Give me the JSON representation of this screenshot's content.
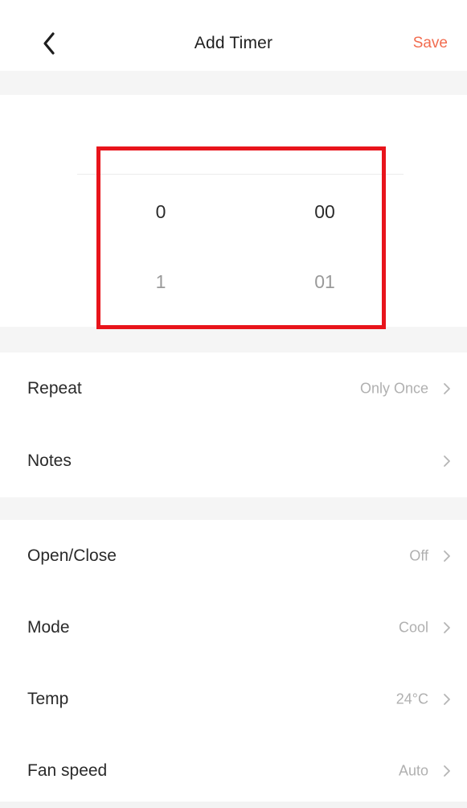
{
  "header": {
    "title": "Add Timer",
    "save_label": "Save",
    "back_icon": "chevron-left-icon"
  },
  "picker": {
    "hours": {
      "selected": "0",
      "next": "1"
    },
    "minutes": {
      "selected": "00",
      "next": "01"
    }
  },
  "settings_group_1": [
    {
      "label": "Repeat",
      "value": "Only Once"
    },
    {
      "label": "Notes",
      "value": ""
    }
  ],
  "settings_group_2": [
    {
      "label": "Open/Close",
      "value": "Off"
    },
    {
      "label": "Mode",
      "value": "Cool"
    },
    {
      "label": "Temp",
      "value": "24°C"
    },
    {
      "label": "Fan speed",
      "value": "Auto"
    }
  ],
  "colors": {
    "accent": "#f26c4f",
    "highlight": "#e8141b",
    "divider_bg": "#f5f5f5"
  }
}
